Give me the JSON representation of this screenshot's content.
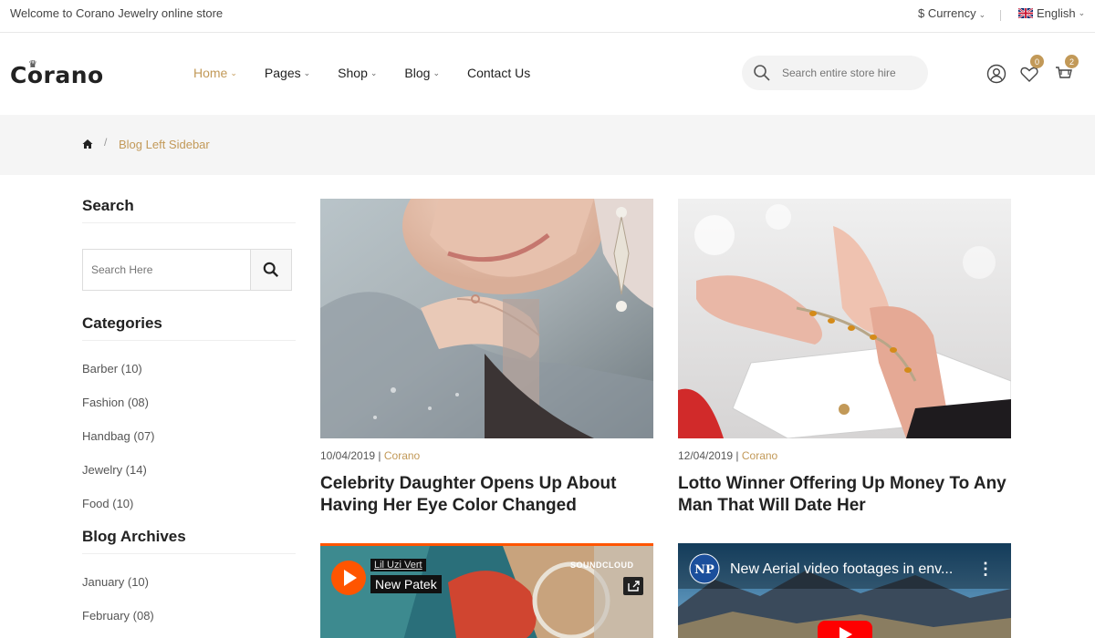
{
  "topbar": {
    "welcome": "Welcome to Corano Jewelry online store",
    "currency": "$ Currency",
    "language": "English"
  },
  "header": {
    "logo": "Corano",
    "nav": [
      "Home",
      "Pages",
      "Shop",
      "Blog",
      "Contact Us"
    ],
    "search_placeholder": "Search entire store hire",
    "wishlist_count": "0",
    "cart_count": "2"
  },
  "breadcrumb": {
    "current": "Blog Left Sidebar"
  },
  "sidebar": {
    "search_title": "Search",
    "search_placeholder": "Search Here",
    "categories_title": "Categories",
    "categories": [
      "Barber (10)",
      "Fashion (08)",
      "Handbag (07)",
      "Jewelry (14)",
      "Food (10)"
    ],
    "archives_title": "Blog Archives",
    "archives": [
      "January (10)",
      "February (08)"
    ]
  },
  "posts": [
    {
      "date": "10/04/2019",
      "author": "Corano",
      "title": "Celebrity Daughter Opens Up About Having Her Eye Color Changed"
    },
    {
      "date": "12/04/2019",
      "author": "Corano",
      "title": "Lotto Winner Offering Up Money To Any Man That Will Date Her"
    }
  ],
  "embeds": {
    "soundcloud": {
      "artist": "Lil Uzi Vert",
      "track": "New Patek",
      "brand": "SOUNDCLOUD"
    },
    "youtube": {
      "title": "New Aerial video footages in env..."
    }
  },
  "colors": {
    "accent": "#c29958",
    "text": "#222222",
    "band": "#f5f5f5"
  }
}
